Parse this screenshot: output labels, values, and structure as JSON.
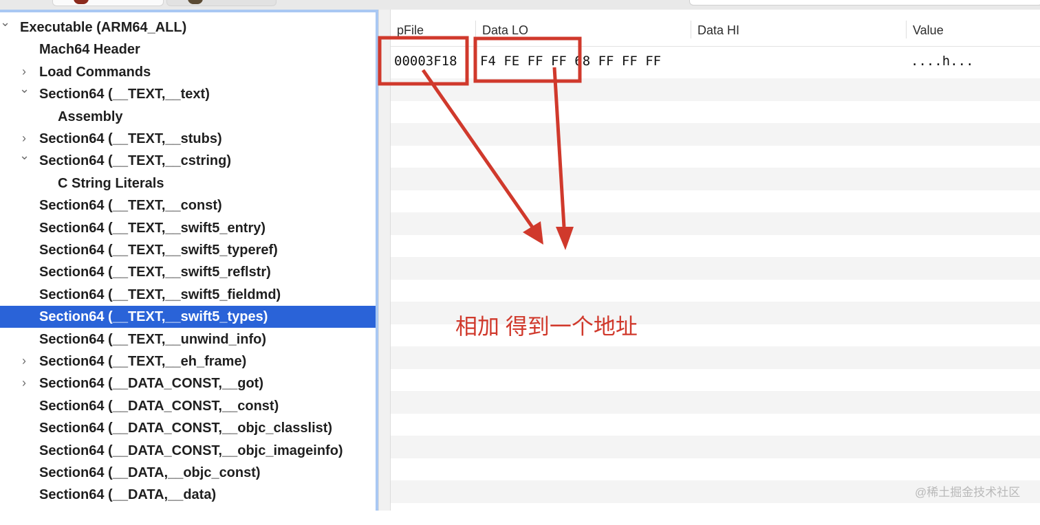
{
  "outline": {
    "items": [
      {
        "label": "Executable  (ARM64_ALL)",
        "level": 0,
        "disclosure": "expanded",
        "selected": false
      },
      {
        "label": "Mach64 Header",
        "level": 1,
        "disclosure": "none",
        "selected": false
      },
      {
        "label": "Load Commands",
        "level": 1,
        "disclosure": "collapsed",
        "selected": false
      },
      {
        "label": "Section64 (__TEXT,__text)",
        "level": 1,
        "disclosure": "expanded",
        "selected": false
      },
      {
        "label": "Assembly",
        "level": 2,
        "disclosure": "none",
        "selected": false
      },
      {
        "label": "Section64 (__TEXT,__stubs)",
        "level": 1,
        "disclosure": "collapsed",
        "selected": false
      },
      {
        "label": "Section64 (__TEXT,__cstring)",
        "level": 1,
        "disclosure": "expanded",
        "selected": false
      },
      {
        "label": "C String Literals",
        "level": 2,
        "disclosure": "none",
        "selected": false
      },
      {
        "label": "Section64 (__TEXT,__const)",
        "level": 1,
        "disclosure": "none",
        "selected": false
      },
      {
        "label": "Section64 (__TEXT,__swift5_entry)",
        "level": 1,
        "disclosure": "none",
        "selected": false
      },
      {
        "label": "Section64 (__TEXT,__swift5_typeref)",
        "level": 1,
        "disclosure": "none",
        "selected": false
      },
      {
        "label": "Section64 (__TEXT,__swift5_reflstr)",
        "level": 1,
        "disclosure": "none",
        "selected": false
      },
      {
        "label": "Section64 (__TEXT,__swift5_fieldmd)",
        "level": 1,
        "disclosure": "none",
        "selected": false
      },
      {
        "label": "Section64 (__TEXT,__swift5_types)",
        "level": 1,
        "disclosure": "none",
        "selected": true
      },
      {
        "label": "Section64 (__TEXT,__unwind_info)",
        "level": 1,
        "disclosure": "none",
        "selected": false
      },
      {
        "label": "Section64 (__TEXT,__eh_frame)",
        "level": 1,
        "disclosure": "collapsed",
        "selected": false
      },
      {
        "label": "Section64 (__DATA_CONST,__got)",
        "level": 1,
        "disclosure": "collapsed",
        "selected": false
      },
      {
        "label": "Section64 (__DATA_CONST,__const)",
        "level": 1,
        "disclosure": "none",
        "selected": false
      },
      {
        "label": "Section64 (__DATA_CONST,__objc_classlist)",
        "level": 1,
        "disclosure": "none",
        "selected": false
      },
      {
        "label": "Section64 (__DATA_CONST,__objc_imageinfo)",
        "level": 1,
        "disclosure": "none",
        "selected": false
      },
      {
        "label": "Section64 (__DATA,__objc_const)",
        "level": 1,
        "disclosure": "none",
        "selected": false
      },
      {
        "label": "Section64 (__DATA,__data)",
        "level": 1,
        "disclosure": "none",
        "selected": false
      }
    ]
  },
  "table": {
    "columns": [
      "pFile",
      "Data LO",
      "Data HI",
      "Value"
    ],
    "rows": [
      {
        "pfile": "00003F18",
        "data_lo": "F4 FE FF FF 68 FF FF FF",
        "data_hi": "",
        "value": "....h..."
      }
    ]
  },
  "annotation": {
    "text": "相加 得到一个地址",
    "color": "#d0392c"
  },
  "watermark": "@稀土掘金技术社区",
  "colors": {
    "selection": "#2a63d8",
    "focus_ring": "#a9c8f3",
    "annotation": "#d0392c"
  }
}
